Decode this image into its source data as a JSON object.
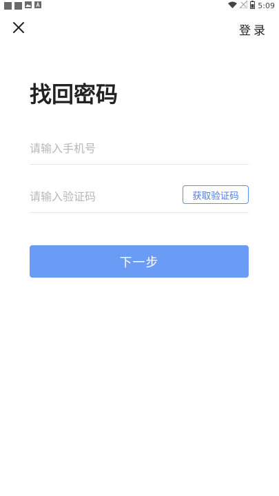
{
  "status_bar": {
    "time": "5:09",
    "icons": [
      "notification-square-icon",
      "notification-square-icon",
      "image-icon",
      "font-icon",
      "wifi-icon",
      "no-signal-icon",
      "battery-icon"
    ]
  },
  "app_bar": {
    "close_icon": "close-icon",
    "login_label": "登录"
  },
  "page": {
    "title": "找回密码"
  },
  "form": {
    "phone": {
      "placeholder": "请输入手机号",
      "value": ""
    },
    "code": {
      "placeholder": "请输入验证码",
      "value": ""
    },
    "get_code_label": "获取验证码",
    "next_label": "下一步"
  },
  "colors": {
    "primary": "#6b9cf5",
    "primary_border": "#5b8ff2",
    "placeholder": "#b7b7b7",
    "divider": "#e6e6e6"
  }
}
